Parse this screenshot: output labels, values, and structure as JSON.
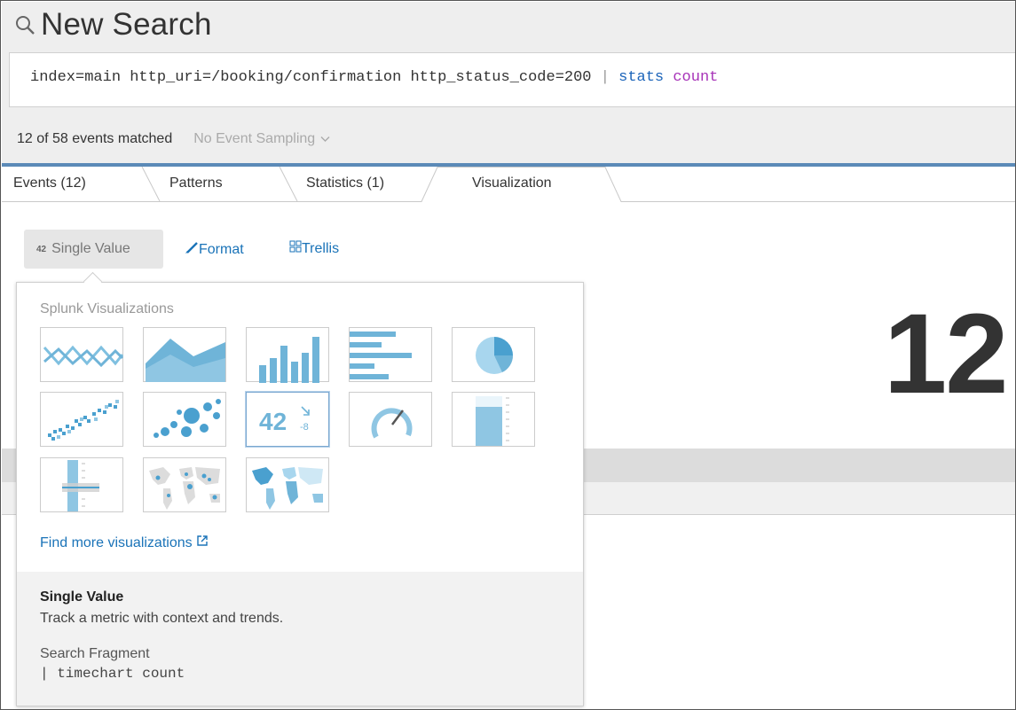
{
  "header": {
    "title": "New Search",
    "icons": {
      "search": "search-icon"
    }
  },
  "search": {
    "query_parts": {
      "base": "index=main http_uri=/booking/confirmation http_status_code=200 ",
      "pipe": "|",
      "command": "stats",
      "function": "count"
    }
  },
  "status": {
    "matched": "12 of 58 events matched",
    "sampling": "No Event Sampling"
  },
  "tabs": [
    {
      "label": "Events (12)"
    },
    {
      "label": "Patterns"
    },
    {
      "label": "Statistics (1)"
    },
    {
      "label": "Visualization",
      "active": true
    }
  ],
  "toolbar": {
    "vis_label": "Single Value",
    "vis_icon_text": "42",
    "format_label": "Format",
    "trellis_label": "Trellis"
  },
  "result": {
    "value": "12"
  },
  "picker": {
    "section_title": "Splunk Visualizations",
    "tiles": [
      {
        "name": "line-chart-icon"
      },
      {
        "name": "area-chart-icon"
      },
      {
        "name": "column-chart-icon"
      },
      {
        "name": "bar-chart-icon"
      },
      {
        "name": "pie-chart-icon"
      },
      {
        "name": "scatter-chart-icon"
      },
      {
        "name": "bubble-chart-icon"
      },
      {
        "name": "single-value-icon",
        "selected": true,
        "text": "42"
      },
      {
        "name": "radial-gauge-icon"
      },
      {
        "name": "filler-gauge-icon"
      },
      {
        "name": "marker-gauge-icon"
      },
      {
        "name": "cluster-map-icon"
      },
      {
        "name": "choropleth-map-icon"
      }
    ],
    "find_more": "Find more visualizations",
    "detail": {
      "title": "Single Value",
      "description": "Track a metric with context and trends.",
      "fragment_label": "Search Fragment",
      "fragment_code": "| timechart count"
    }
  },
  "colors": {
    "accent_blue": "#5b8ab7",
    "link": "#1a73b8",
    "viz_blue": "#6fb4d8"
  }
}
